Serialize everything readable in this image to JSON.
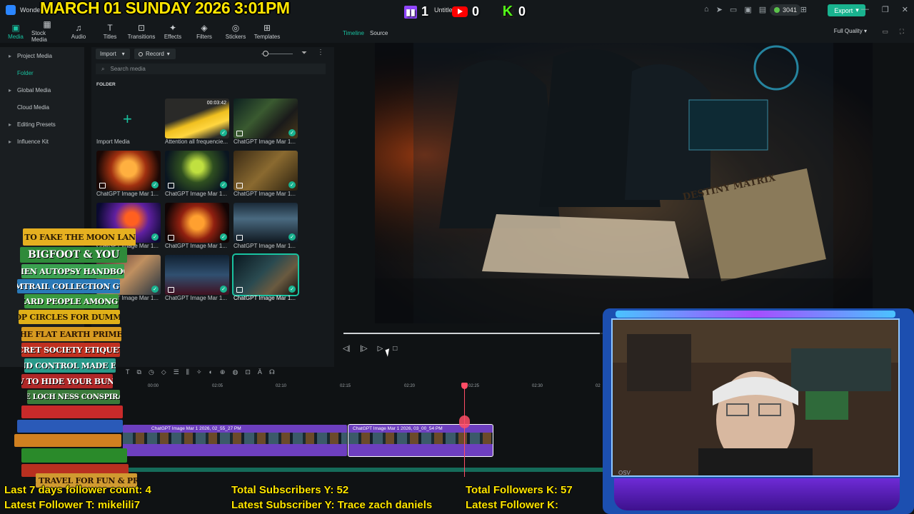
{
  "window": {
    "app_name": "Wondershare",
    "project_title": "Untitle"
  },
  "overlay": {
    "date_time": "MARCH 01 SUNDAY 2026 3:01PM",
    "twitch_count": "1",
    "youtube_count": "0",
    "kick_count": "0",
    "kick_logo": "K"
  },
  "topbar": {
    "credits": "3041",
    "export_label": "Export"
  },
  "toolbar": {
    "items": [
      {
        "label": "Media",
        "icon": "media-icon"
      },
      {
        "label": "Stock Media",
        "icon": "stock-media-icon"
      },
      {
        "label": "Audio",
        "icon": "audio-icon"
      },
      {
        "label": "Titles",
        "icon": "titles-icon"
      },
      {
        "label": "Transitions",
        "icon": "transitions-icon"
      },
      {
        "label": "Effects",
        "icon": "effects-icon"
      },
      {
        "label": "Filters",
        "icon": "filters-icon"
      },
      {
        "label": "Stickers",
        "icon": "stickers-icon"
      },
      {
        "label": "Templates",
        "icon": "templates-icon"
      }
    ]
  },
  "leftnav": {
    "items": [
      {
        "label": "Project Media"
      },
      {
        "label": "Folder"
      },
      {
        "label": "Global Media"
      },
      {
        "label": "Cloud Media"
      },
      {
        "label": "Editing Presets"
      },
      {
        "label": "Influence Kit"
      }
    ]
  },
  "media": {
    "import_label": "Import",
    "record_label": "Record",
    "search_placeholder": "Search media",
    "folder_label": "FOLDER",
    "import_media_label": "Import Media",
    "items": [
      {
        "label": "Attention all frequencie...",
        "duration": "00:03:42"
      },
      {
        "label": "ChatGPT Image Mar 1..."
      },
      {
        "label": "ChatGPT Image Mar 1..."
      },
      {
        "label": "ChatGPT Image Mar 1..."
      },
      {
        "label": "ChatGPT Image Mar 1..."
      },
      {
        "label": "ChatGPT Image Mar 1..."
      },
      {
        "label": "ChatGPT Image Mar 1..."
      },
      {
        "label": "ChatGPT Image Mar 1..."
      },
      {
        "label": "ChatGPT Image Mar 1..."
      },
      {
        "label": "ChatGPT Image Mar 1..."
      },
      {
        "label": "ChatGPT Image Mar 1..."
      }
    ]
  },
  "preview": {
    "tab_timeline": "Timeline",
    "tab_source": "Source",
    "quality": "Full Quality",
    "image_text": "DESTINY MATRIX",
    "progress": 0.97
  },
  "timeline": {
    "ticks": [
      "00:00",
      "02:05",
      "02:10",
      "02:15",
      "02:20",
      "02:25",
      "02:30",
      "02"
    ],
    "clips": [
      {
        "label": "ChatGPT Image Mar 1 2026, 02_55_27 PM"
      },
      {
        "label": "ChatGPT Image Mar 1 2026, 03_00_54 PM"
      }
    ]
  },
  "books": [
    "HOW TO FAKE THE MOON LANDING",
    "BIGFOOT & YOU",
    "ALIEN AUTOPSY HANDBOOK",
    "CHEMTRAIL COLLECTION GUIDE",
    "LIZARD PEOPLE AMONG US",
    "CROP CIRCLES FOR DUMMIES",
    "THE FLAT EARTH PRIMER",
    "SECRET SOCIETY ETIQUETTE",
    "MIND CONTROL MADE EASY",
    "HOW TO HIDE YOUR BUNKER",
    "THE LOCH NESS CONSPIRACY",
    "TIME TRAVEL FOR FUN & PROFIT"
  ],
  "webcam": {
    "label": "OSV"
  },
  "bottom_stats": {
    "twitch_followers": "Last 7 days follower count: 4",
    "twitch_latest": "Latest Follower T: mikelili7",
    "yt_subs": "Total Subscribers Y: 52",
    "yt_latest": "Latest Subscriber Y: Trace zach daniels",
    "kick_followers": "Total Followers K: 57",
    "kick_latest": "Latest Follower K:"
  },
  "colors": {
    "accent": "#19c2a0",
    "overlay_yellow": "#ffe600",
    "clip_purple": "#6d3fbf",
    "playhead": "#ff4d66"
  }
}
